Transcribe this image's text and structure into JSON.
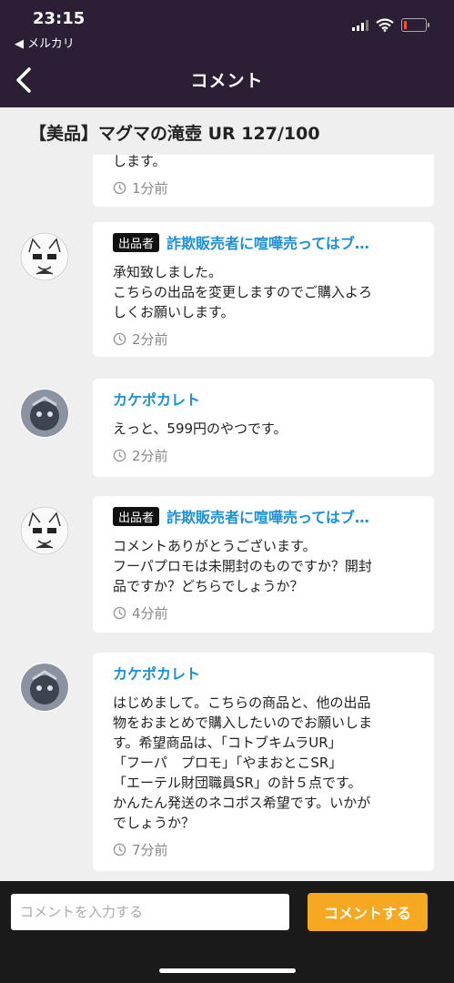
{
  "status": {
    "time": "23:15",
    "back_app": "◀ メルカリ",
    "battery_level": 0.12
  },
  "header": {
    "title": "コメント"
  },
  "item": {
    "title": "【美品】マグマの滝壺 UR 127/100"
  },
  "comments": [
    {
      "seller": false,
      "name": "",
      "message": "します。",
      "time": "1分前"
    },
    {
      "seller": true,
      "badge": "出品者",
      "name": "詐欺販売者に喧嘩売ってはブ…",
      "message": "承知致しました。\nこちらの出品を変更しますのでご購入よろ\nしくお願いします。",
      "time": "2分前"
    },
    {
      "seller": false,
      "name": "カケポカレト",
      "message": "えっと、599円のやつです。",
      "time": "2分前"
    },
    {
      "seller": true,
      "badge": "出品者",
      "name": "詐欺販売者に喧嘩売ってはブ…",
      "message": "コメントありがとうございます。\nフーパプロモは未開封のものですか？開封\n品ですか？どちらでしょうか？",
      "time": "4分前"
    },
    {
      "seller": false,
      "name": "カケポカレト",
      "message": "はじめまして。こちらの商品と、他の出品\n物をおまとめで購入したいのでお願いしま\nす。希望商品は、「コトブキムラUR」\n「フーパ　プロモ」「やまおとこSR」\n「エーテル財団職員SR」の計５点です。\nかんたん発送のネコポス希望です。いかが\nでしょうか？",
      "time": "7分前"
    }
  ],
  "input": {
    "placeholder": "コメントを入力する",
    "value": ""
  },
  "submit": {
    "label": "コメントする"
  },
  "icons": {
    "back": "chevron-left-icon",
    "clock": "clock-icon",
    "wifi": "wifi-icon",
    "battery": "battery-icon",
    "signal": "signal-icon"
  },
  "colors": {
    "header_bg": "#2a1f35",
    "username": "#1b8fd8",
    "button": "#f6a820"
  }
}
